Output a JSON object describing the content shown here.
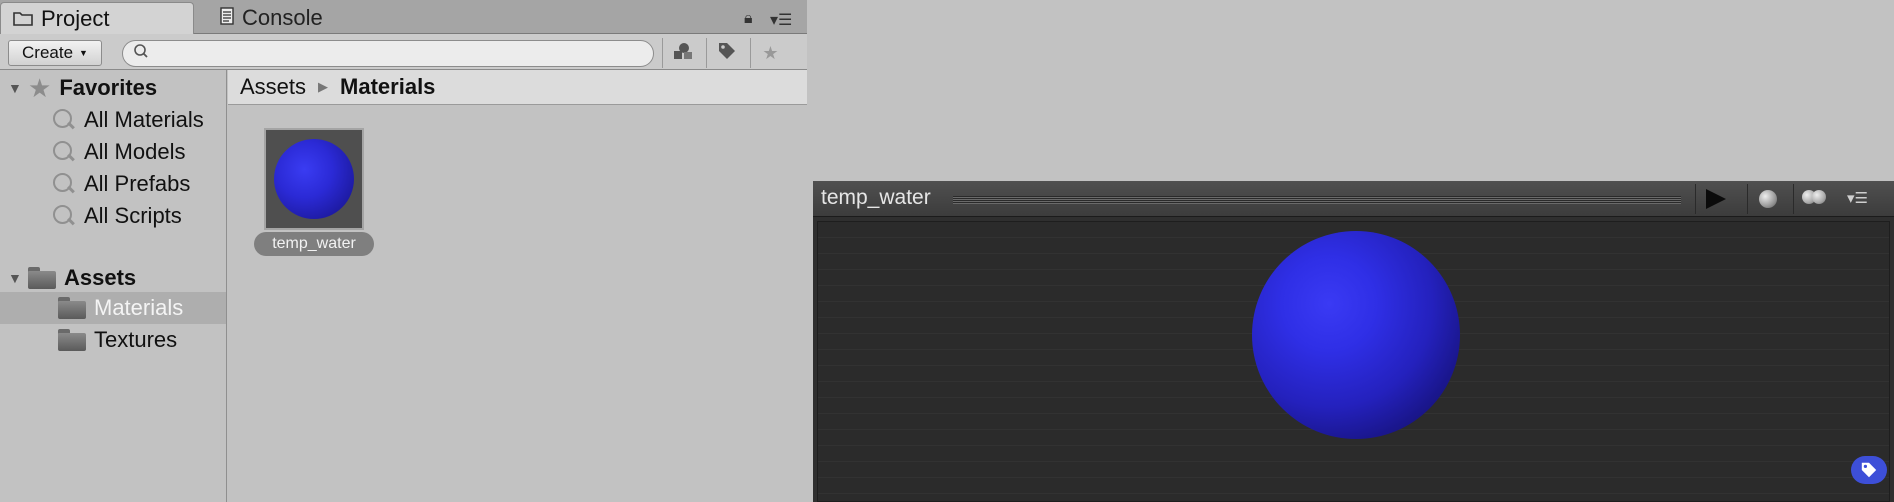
{
  "tabs": {
    "project_label": "Project",
    "console_label": "Console"
  },
  "toolbar": {
    "create_label": "Create",
    "search_value": "",
    "search_placeholder": ""
  },
  "sidebar": {
    "favorites_label": "Favorites",
    "favorites": [
      "All Materials",
      "All Models",
      "All Prefabs",
      "All Scripts"
    ],
    "assets_label": "Assets",
    "folders": [
      "Materials",
      "Textures"
    ],
    "selected_folder": "Materials"
  },
  "breadcrumb": {
    "root": "Assets",
    "current": "Materials"
  },
  "assets": [
    {
      "name": "temp_water",
      "type": "material",
      "color": "#2b2ad6"
    }
  ],
  "preview": {
    "title": "temp_water",
    "material_color": "#2f2fe6"
  },
  "icons": {
    "project_tab": "folder-icon",
    "console_tab": "console-icon",
    "lock": "lock-icon",
    "search": "search-icon",
    "filter_type": "filter-by-type-icon",
    "filter_label": "filter-by-label-icon",
    "favorite": "star-icon",
    "play": "play-icon",
    "label": "tag-icon"
  }
}
